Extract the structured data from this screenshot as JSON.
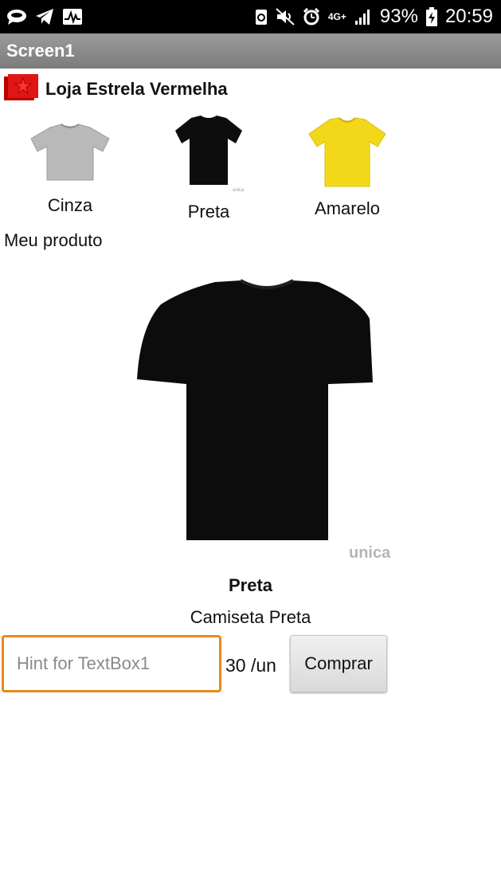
{
  "status_bar": {
    "battery_percent": "93%",
    "time": "20:59",
    "network": "4G+",
    "icons": [
      "chat-bubble-icon",
      "telegram-icon",
      "pulse-icon",
      "recycle-badge-icon",
      "mute-icon",
      "alarm-icon",
      "signal-icon",
      "battery-charging-icon"
    ]
  },
  "app": {
    "title": "Screen1"
  },
  "store": {
    "title": "Loja Estrela Vermelha",
    "logo_color": "#d81010"
  },
  "options": [
    {
      "label": "Cinza",
      "color": "#b8b8b8"
    },
    {
      "label": "Preta",
      "color": "#0d0d0d"
    },
    {
      "label": "Amarelo",
      "color": "#f3d81a"
    }
  ],
  "section_label": "Meu produto",
  "product": {
    "name": "Preta",
    "description": "Camiseta Preta",
    "watermark": "unica"
  },
  "order": {
    "placeholder": "Hint for TextBox1",
    "value": "",
    "price": "30 /un",
    "buy_label": "Comprar"
  },
  "colors": {
    "accent_border": "#e88a1a",
    "titlebar": "#8a8a8a"
  }
}
